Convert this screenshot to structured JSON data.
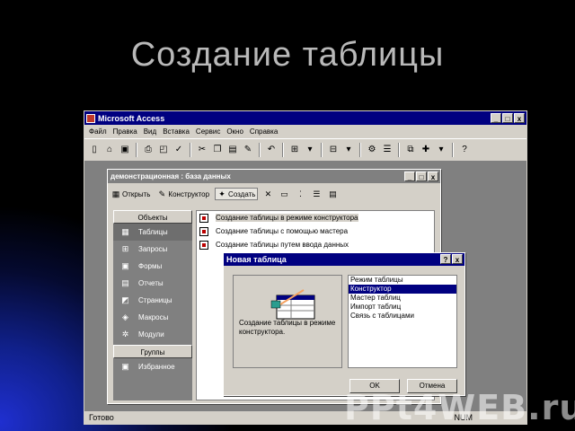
{
  "slide": {
    "title": "Создание таблицы"
  },
  "app": {
    "title": "Microsoft Access",
    "window_buttons": [
      "_",
      "□",
      "x"
    ],
    "menu": [
      "Файл",
      "Правка",
      "Вид",
      "Вставка",
      "Сервис",
      "Окно",
      "Справка"
    ],
    "status_text": "Готово",
    "status_right": "NUM"
  },
  "db_window": {
    "title": "демонстрационная : база данных",
    "toolbar": {
      "open": "Открыть",
      "design": "Конструктор",
      "create": "Создать"
    },
    "objects_header": "Объекты",
    "objects": [
      {
        "label": "Таблицы",
        "icon": "table-icon"
      },
      {
        "label": "Запросы",
        "icon": "query-icon"
      },
      {
        "label": "Формы",
        "icon": "form-icon"
      },
      {
        "label": "Отчеты",
        "icon": "report-icon"
      },
      {
        "label": "Страницы",
        "icon": "page-icon"
      },
      {
        "label": "Макросы",
        "icon": "macro-icon"
      },
      {
        "label": "Модули",
        "icon": "module-icon"
      }
    ],
    "groups_header": "Группы",
    "groups": [
      {
        "label": "Избранное",
        "icon": "favorites-icon"
      }
    ],
    "list": [
      "Создание таблицы в режиме конструктора",
      "Создание таблицы с помощью мастера",
      "Создание таблицы путем ввода данных"
    ]
  },
  "dialog": {
    "title": "Новая таблица",
    "help_btn": "?",
    "close_btn": "x",
    "description": "Создание таблицы в режиме конструктора.",
    "options": [
      "Режим таблицы",
      "Конструктор",
      "Мастер таблиц",
      "Импорт таблиц",
      "Связь с таблицами"
    ],
    "selected_option": "Конструктор",
    "ok": "OK",
    "cancel": "Отмена"
  },
  "watermark": "PPt4WEB.ru"
}
